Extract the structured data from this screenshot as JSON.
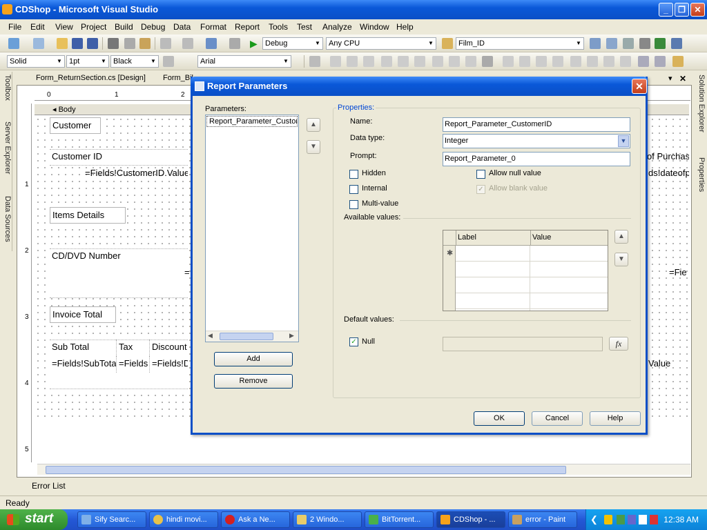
{
  "window": {
    "title": "CDShop - Microsoft Visual Studio"
  },
  "menu": [
    "File",
    "Edit",
    "View",
    "Project",
    "Build",
    "Debug",
    "Data",
    "Format",
    "Report",
    "Tools",
    "Test",
    "Analyze",
    "Window",
    "Help"
  ],
  "toolbar1": {
    "config": "Debug",
    "platform": "Any CPU",
    "find": "Film_ID"
  },
  "toolbar2": {
    "line_style": "Solid",
    "line_width": "1pt",
    "color": "Black",
    "font": "Arial"
  },
  "side_tabs_left": [
    "Toolbox",
    "Server Explorer",
    "Data Sources"
  ],
  "side_tabs_right": [
    "Solution Explorer",
    "Properties"
  ],
  "doc_tabs": [
    "Form_ReturnSection.cs [Design]",
    "Form_Bil"
  ],
  "ruler": {
    "h": [
      "0",
      "1",
      "2"
    ],
    "v": [
      "1",
      "2",
      "3",
      "4",
      "5"
    ]
  },
  "report": {
    "band": "Body",
    "boxes": {
      "customer": "Customer",
      "customer_id": "Customer ID",
      "customer_id_expr": "=Fields!CustomerID.Value",
      "of_purchase": "of Purchas",
      "dateofp": "ds!dateofp",
      "items_details": "Items Details",
      "cd_number": "CD/DVD  Number",
      "eq": "=",
      "fie": "=Fie",
      "invoice_total": "Invoice Total",
      "sub_total": "Sub Total",
      "tax": "Tax",
      "discount": "Discount",
      "sub_total_expr": "=Fields!SubTota",
      "tax_expr": "=Fields",
      "discount_expr": "=Fields!D",
      "value": "Value"
    }
  },
  "error_list": "Error List",
  "status": "Ready",
  "dialog": {
    "title": "Report Parameters",
    "parameters_label": "Parameters:",
    "parameters": [
      "Report_Parameter_Custon"
    ],
    "add": "Add",
    "remove": "Remove",
    "properties_label": "Properties:",
    "name_label": "Name:",
    "name_value": "Report_Parameter_CustomerID",
    "datatype_label": "Data type:",
    "datatype_value": "Integer",
    "prompt_label": "Prompt:",
    "prompt_value": "Report_Parameter_0",
    "hidden": "Hidden",
    "internal": "Internal",
    "multivalue": "Multi-value",
    "allow_null": "Allow null value",
    "allow_blank": "Allow blank value",
    "available_values": "Available values:",
    "grid_cols": [
      "Label",
      "Value"
    ],
    "default_values": "Default values:",
    "null": "Null",
    "ok": "OK",
    "cancel": "Cancel",
    "help": "Help",
    "fx": "fx"
  },
  "taskbar": {
    "start": "start",
    "tasks": [
      "Sify Searc...",
      "hindi movi...",
      "Ask a Ne...",
      "2 Windo...",
      "BitTorrent...",
      "CDShop - ...",
      "error - Paint"
    ],
    "clock": "12:38 AM"
  }
}
